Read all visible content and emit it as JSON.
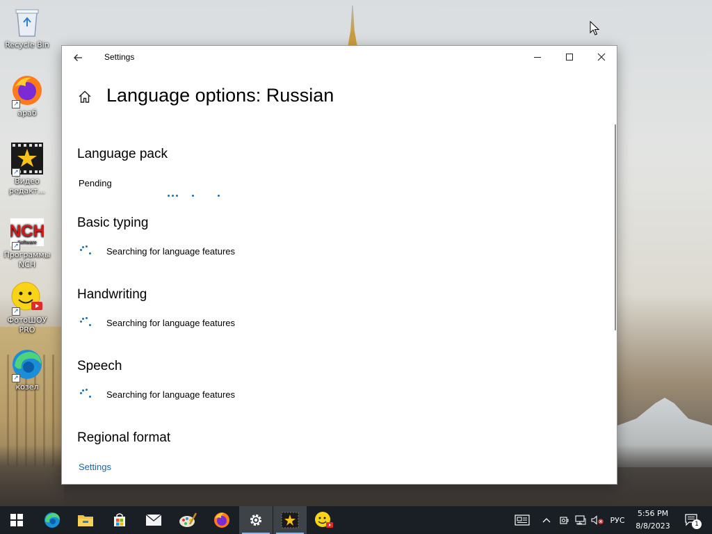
{
  "desktop": {
    "icons": [
      {
        "label": "Recycle Bin",
        "icon": "recycle-bin-icon"
      },
      {
        "label": "араб",
        "icon": "firefox-icon"
      },
      {
        "label": "Видео редакт...",
        "icon": "video-editor-icon"
      },
      {
        "label": "Программы NCH",
        "icon": "nch-software-icon"
      },
      {
        "label": "ФотоШОУ PRO",
        "icon": "photoshow-pro-icon"
      },
      {
        "label": "козел",
        "icon": "edge-icon"
      }
    ],
    "nch_logo_sub": "Software"
  },
  "window": {
    "app_title": "Settings",
    "page_title": "Language options: Russian",
    "controls": {
      "minimize": "—",
      "maximize": "☐",
      "close": "✕"
    }
  },
  "sections": {
    "language_pack": {
      "heading": "Language pack",
      "status": "Pending"
    },
    "basic_typing": {
      "heading": "Basic typing",
      "status": "Searching for language features"
    },
    "handwriting": {
      "heading": "Handwriting",
      "status": "Searching for language features"
    },
    "speech": {
      "heading": "Speech",
      "status": "Searching for language features"
    },
    "regional_format": {
      "heading": "Regional format",
      "link": "Settings"
    }
  },
  "taskbar": {
    "apps": [
      "start-icon",
      "edge-icon",
      "file-explorer-icon",
      "store-icon",
      "mail-icon",
      "paint-icon",
      "firefox-icon",
      "settings-icon",
      "video-editor-icon",
      "photoshow-pro-icon"
    ],
    "active_app": "settings-icon",
    "language": "РУС",
    "time": "5:56 PM",
    "date": "8/8/2023",
    "notification_count": "1"
  },
  "colors": {
    "accent": "#1f6fb2",
    "link": "#1467b3",
    "taskbar": "#161c22"
  }
}
